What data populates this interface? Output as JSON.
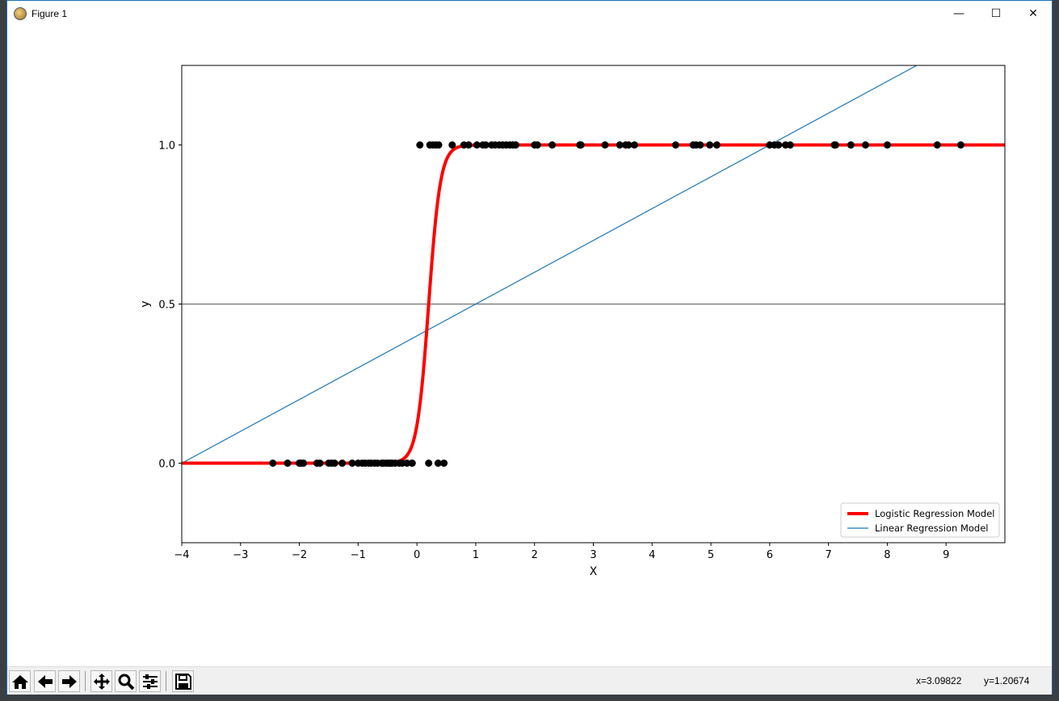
{
  "window": {
    "title": "Figure 1"
  },
  "window_controls": {
    "minimize": "—",
    "maximize": "☐",
    "close": "✕"
  },
  "toolbar": {
    "buttons": [
      "home-icon",
      "back-icon",
      "forward-icon",
      "pan-icon",
      "zoom-icon",
      "configure-subplots-icon",
      "save-icon"
    ]
  },
  "status": {
    "x_readout": "x=3.09822",
    "y_readout": "y=1.20674"
  },
  "chart_data": {
    "type": "line",
    "title": "",
    "xlabel": "X",
    "ylabel": "y",
    "xlim": [
      -4,
      10
    ],
    "ylim": [
      -0.25,
      1.25
    ],
    "xticks": [
      -4,
      -3,
      -2,
      -1,
      0,
      1,
      2,
      3,
      4,
      5,
      6,
      7,
      8,
      9
    ],
    "xtick_labels": [
      "−4",
      "−3",
      "−2",
      "−1",
      "0",
      "1",
      "2",
      "3",
      "4",
      "5",
      "6",
      "7",
      "8",
      "9"
    ],
    "yticks": [
      0.0,
      0.5,
      1.0
    ],
    "ytick_labels": [
      "0.0",
      "0.5",
      "1.0"
    ],
    "grid": false,
    "legend": {
      "position": "lower right",
      "entries": [
        "Logistic Regression Model",
        "Linear Regression Model"
      ]
    },
    "reference_line": {
      "y": 0.5,
      "color": "#808080"
    },
    "series": [
      {
        "name": "Logistic Regression Model",
        "kind": "sigmoid",
        "k": 10,
        "x0": 0.2,
        "color": "#ff0000"
      },
      {
        "name": "Linear Regression Model",
        "kind": "linear",
        "slope": 0.1,
        "intercept": 0.4,
        "color": "#1f77b4"
      }
    ],
    "points_color": "#000000",
    "points_y0": [
      -2.45,
      -2.2,
      -2.0,
      -1.97,
      -1.93,
      -1.7,
      -1.65,
      -1.5,
      -1.45,
      -1.4,
      -1.27,
      -1.1,
      -1.0,
      -0.93,
      -0.88,
      -0.82,
      -0.78,
      -0.72,
      -0.67,
      -0.6,
      -0.57,
      -0.52,
      -0.48,
      -0.45,
      -0.42,
      -0.37,
      -0.3,
      -0.25,
      -0.17,
      -0.08,
      0.2,
      0.36,
      0.46
    ],
    "points_y1": [
      0.05,
      0.22,
      0.27,
      0.32,
      0.37,
      0.6,
      0.8,
      0.88,
      1.02,
      1.12,
      1.17,
      1.27,
      1.33,
      1.4,
      1.46,
      1.52,
      1.58,
      1.63,
      1.68,
      2.0,
      2.05,
      2.3,
      2.77,
      2.79,
      3.2,
      3.45,
      3.55,
      3.6,
      3.7,
      4.4,
      4.7,
      4.75,
      4.82,
      4.98,
      5.1,
      6.0,
      6.08,
      6.15,
      6.27,
      6.35,
      7.1,
      7.12,
      7.38,
      7.63,
      8.0,
      8.85,
      9.25
    ]
  }
}
